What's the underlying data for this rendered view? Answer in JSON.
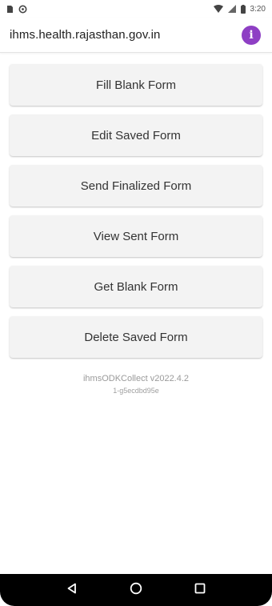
{
  "status_bar": {
    "time": "3:20",
    "icons": [
      "sim-card-icon",
      "sync-icon",
      "wifi-icon",
      "signal-icon",
      "battery-icon"
    ]
  },
  "app_bar": {
    "title": "ihms.health.rajasthan.gov.in",
    "info_icon_glyph": "i",
    "accent_color": "#8e3fc4"
  },
  "menu": {
    "fill_blank_form": "Fill Blank Form",
    "edit_saved_form": "Edit Saved Form",
    "send_finalized_form": "Send Finalized Form",
    "view_sent_form": "View Sent Form",
    "get_blank_form": "Get Blank Form",
    "delete_saved_form": "Delete Saved Form"
  },
  "version": {
    "line1": "ihmsODKCollect v2022.4.2",
    "line2": "1-g5ecdbd95e"
  },
  "nav_bar": {
    "icons": [
      "back-icon",
      "home-icon",
      "recents-icon"
    ]
  }
}
